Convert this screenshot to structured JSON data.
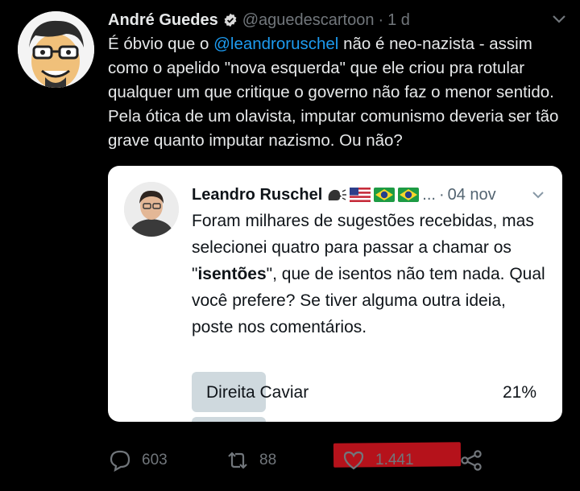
{
  "tweet": {
    "author_name": "André Guedes",
    "handle": "@aguedescartoon",
    "separator": "·",
    "time": "1 d",
    "text_before": "É óbvio que o ",
    "mention": "@leandroruschel",
    "text_after": " não é neo-nazista - assim como o apelido \"nova esquerda\" que ele criou pra rotular qualquer um que critique o governo não faz o menor sentido. Pela ótica de um olavista, imputar comunismo deveria ser tão grave quanto imputar nazismo. Ou não?"
  },
  "quoted": {
    "author_name": "Leandro Ruschel",
    "ellipsis": "...",
    "separator": "·",
    "date": "04 nov",
    "text_part1": "Foram milhares de sugestões recebidas, mas selecionei quatro para passar a chamar os \"",
    "text_bold": "isentões",
    "text_part2": "\", que de isentos não tem nada. Qual você prefere? Se tiver alguma outra ideia, poste nos comentários.",
    "poll": [
      {
        "label": "Direita Caviar",
        "percent_text": "21%",
        "fill_fraction": 0.21
      }
    ],
    "emoji_icons": [
      "speaking-head-icon",
      "flag-us-icon",
      "flag-brazil-icon",
      "flag-brazil-icon"
    ]
  },
  "actions": {
    "replies": "603",
    "retweets": "88",
    "likes": "1.441"
  },
  "colors": {
    "background": "#000000",
    "mention": "#1d9bf0",
    "muted": "#71767b",
    "poll_fill": "#cfd9de",
    "highlight": "#b5121b"
  }
}
